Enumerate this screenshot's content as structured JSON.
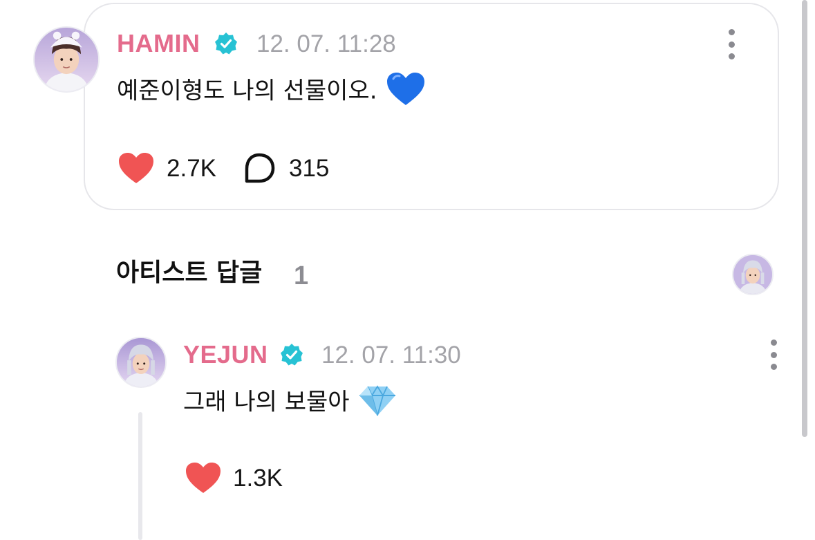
{
  "post": {
    "author": "HAMIN",
    "timestamp": "12. 07. 11:28",
    "text": "예준이형도 나의 선물이오.",
    "emoji": "blue-heart",
    "likes": "2.7K",
    "comments": "315",
    "verified_color": "#27c2d4"
  },
  "artist_replies": {
    "title": "아티스트 답글",
    "count": "1"
  },
  "reply": {
    "author": "YEJUN",
    "timestamp": "12. 07. 11:30",
    "text": "그래 나의 보물아",
    "emoji": "gem-stone",
    "likes": "1.3K"
  },
  "colors": {
    "name": "#e46b8c",
    "heart": "#f05454",
    "meta": "#a3a3a8"
  }
}
